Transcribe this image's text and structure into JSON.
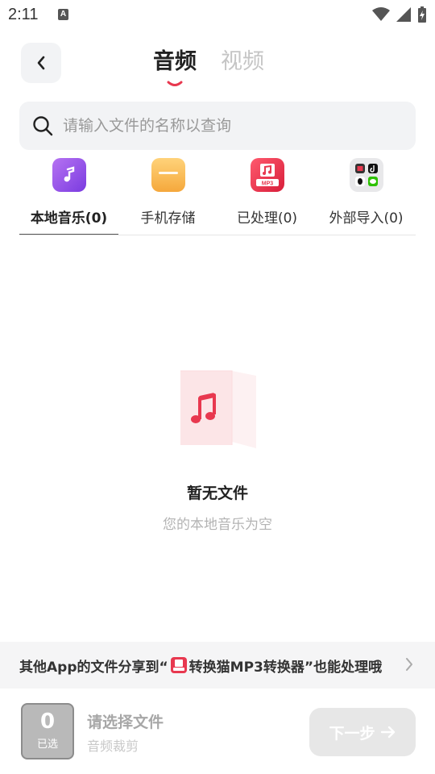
{
  "status_bar": {
    "time": "2:11",
    "notification_letter": "A"
  },
  "header": {
    "tabs": [
      {
        "label": "音频",
        "active": true
      },
      {
        "label": "视频",
        "active": false
      }
    ],
    "accent_color": "#e8384f"
  },
  "search": {
    "placeholder": "请输入文件的名称以查询",
    "value": ""
  },
  "categories": [
    {
      "label": "本地音乐(0)",
      "icon": "music-note-icon",
      "active": true
    },
    {
      "label": "手机存储",
      "icon": "folder-icon",
      "active": false
    },
    {
      "label": "已处理(0)",
      "icon": "mp3-converter-icon",
      "active": false
    },
    {
      "label": "外部导入(0)",
      "icon": "external-apps-icon",
      "active": false
    }
  ],
  "empty_state": {
    "title": "暂无文件",
    "subtitle": "您的本地音乐为空"
  },
  "banner": {
    "prefix": "其他App的文件分享到“",
    "app_name": "转换猫MP3转换器",
    "suffix": "”也能处理哦"
  },
  "bottom": {
    "selected_count": "0",
    "selected_label": "已选",
    "title": "请选择文件",
    "subtitle": "音频裁剪",
    "next_label": "下一步"
  }
}
